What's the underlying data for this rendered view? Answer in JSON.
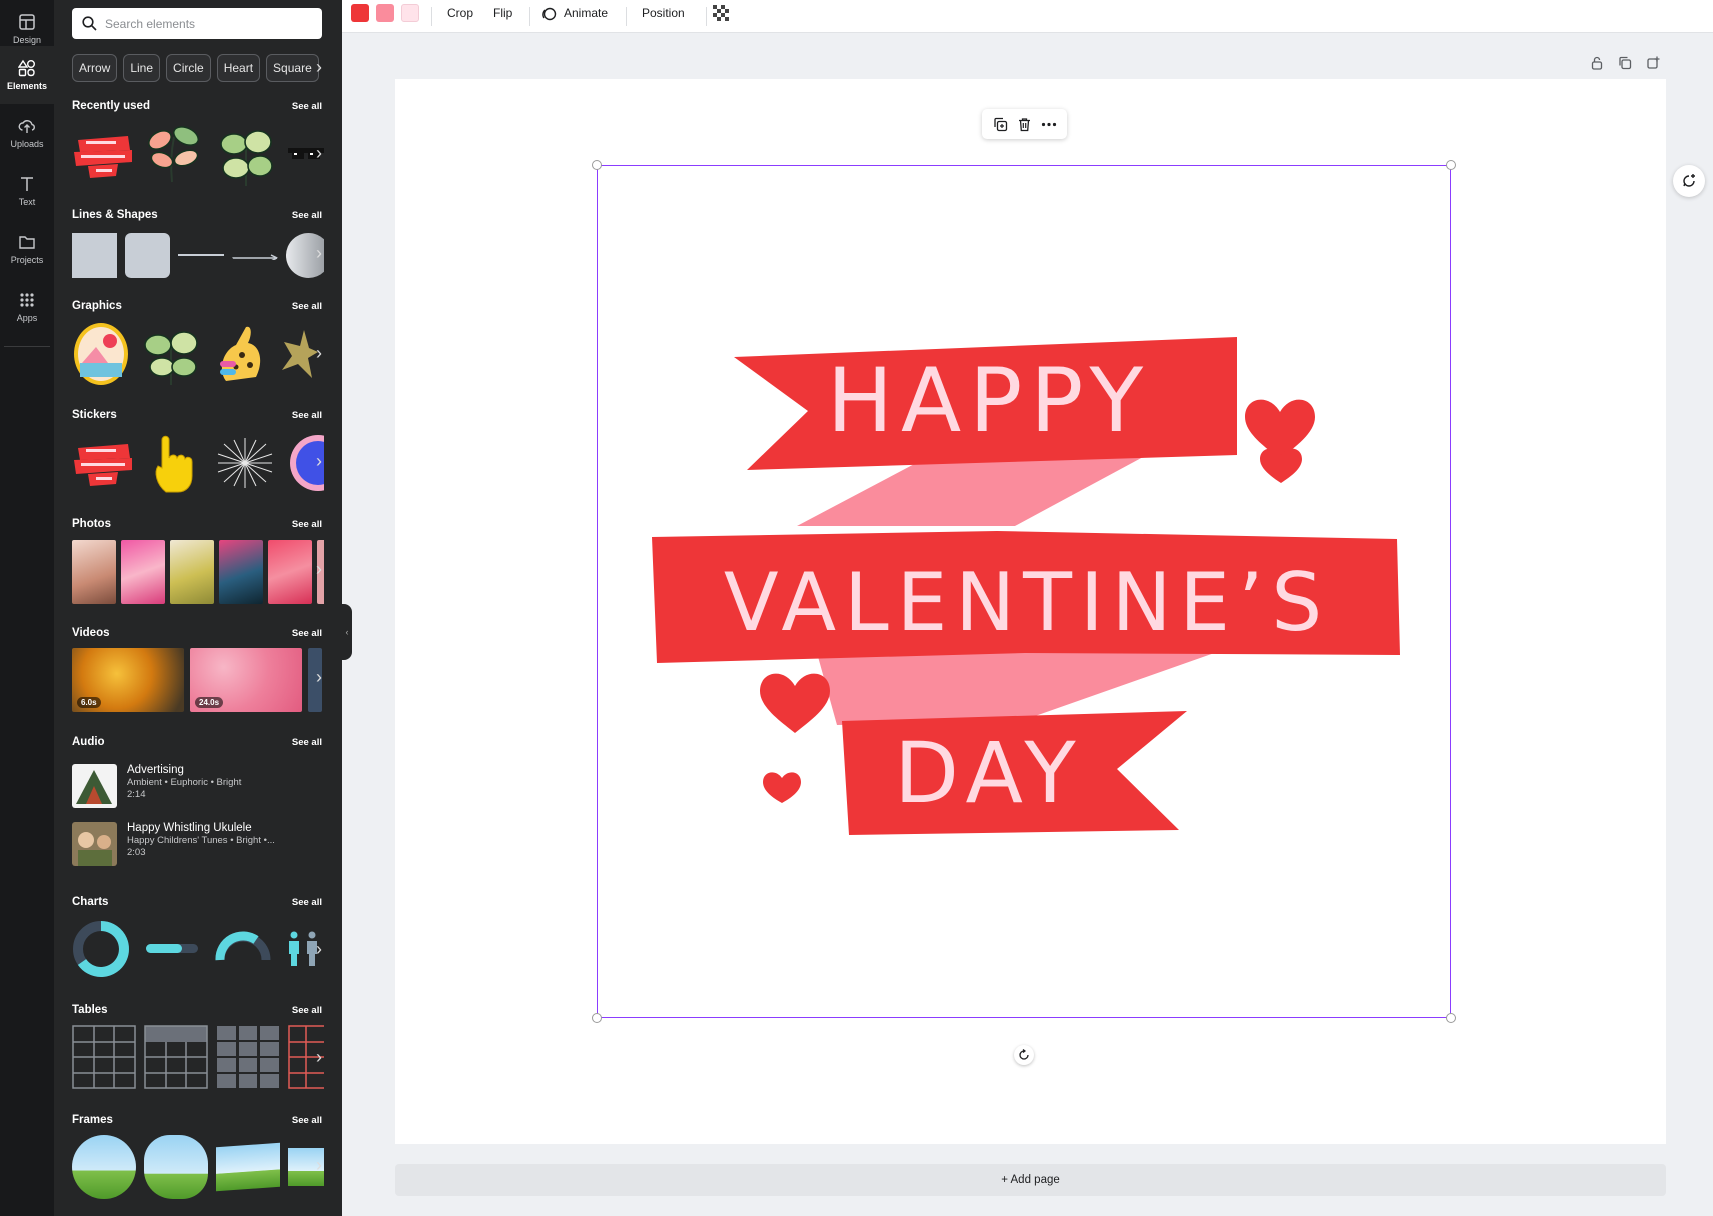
{
  "rail": {
    "items": [
      {
        "label": "Design",
        "icon": "layout-icon"
      },
      {
        "label": "Elements",
        "icon": "shapes-icon"
      },
      {
        "label": "Uploads",
        "icon": "cloud-upload-icon"
      },
      {
        "label": "Text",
        "icon": "text-icon"
      },
      {
        "label": "Projects",
        "icon": "folder-icon"
      },
      {
        "label": "Apps",
        "icon": "grid-icon"
      }
    ]
  },
  "panel": {
    "search_placeholder": "Search elements",
    "chips": [
      "Arrow",
      "Line",
      "Circle",
      "Heart",
      "Square"
    ],
    "see_all": "See all",
    "sections": {
      "recently_used": "Recently used",
      "lines_shapes": "Lines & Shapes",
      "graphics": "Graphics",
      "stickers": "Stickers",
      "photos": "Photos",
      "videos": "Videos",
      "audio": "Audio",
      "charts": "Charts",
      "tables": "Tables",
      "frames": "Frames"
    },
    "videos": [
      {
        "duration": "6.0s"
      },
      {
        "duration": "24.0s"
      }
    ],
    "audio": [
      {
        "title": "Advertising",
        "tags": "Ambient • Euphoric • Bright",
        "duration": "2:14"
      },
      {
        "title": "Happy Whistling Ukulele",
        "tags": "Happy Childrens' Tunes • Bright •...",
        "duration": "2:03"
      }
    ]
  },
  "toolbar": {
    "colors": [
      "#ee3638",
      "#fa8c9c",
      "#ffe3ea"
    ],
    "crop": "Crop",
    "flip": "Flip",
    "animate": "Animate",
    "position": "Position"
  },
  "canvas": {
    "banner": {
      "line1": "HAPPY",
      "line2": "VALENTINE’S",
      "line3": "DAY",
      "ribbon_color": "#ee3638",
      "fold_color": "#fa8c9c",
      "text_color": "#ffd9e1"
    },
    "add_page": "+ Add page",
    "selection_color": "#8b3dff"
  }
}
